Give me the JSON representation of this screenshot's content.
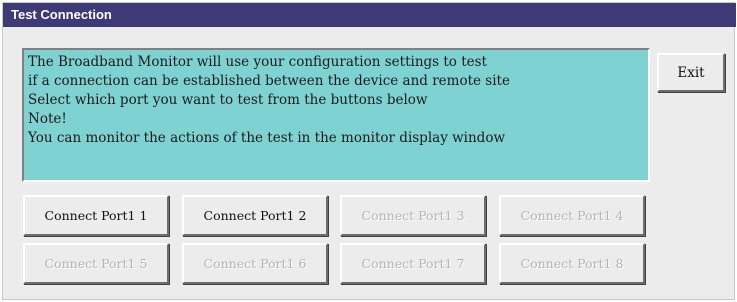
{
  "window": {
    "title": "Test Connection"
  },
  "info_panel": {
    "lines": [
      "The Broadband Monitor will use your configuration settings to test",
      "if a connection can be established between the device and remote site",
      "Select which port you want to test from the buttons below",
      "Note!",
      "You can monitor the actions of the test in the monitor display window"
    ]
  },
  "exit_button": {
    "label": "Exit"
  },
  "port_buttons": [
    {
      "label": "Connect Port1  1",
      "enabled": true
    },
    {
      "label": "Connect Port1  2",
      "enabled": true
    },
    {
      "label": "Connect Port1  3",
      "enabled": false
    },
    {
      "label": "Connect Port1  4",
      "enabled": false
    },
    {
      "label": "Connect Port1  5",
      "enabled": false
    },
    {
      "label": "Connect Port1  6",
      "enabled": false
    },
    {
      "label": "Connect Port1  7",
      "enabled": false
    },
    {
      "label": "Connect Port1  8",
      "enabled": false
    }
  ],
  "colors": {
    "titlebar": "#3e3a78",
    "info_panel_background": "#7fd2d2",
    "window_background": "#ececec",
    "disabled_text": "#b4b4b4"
  }
}
